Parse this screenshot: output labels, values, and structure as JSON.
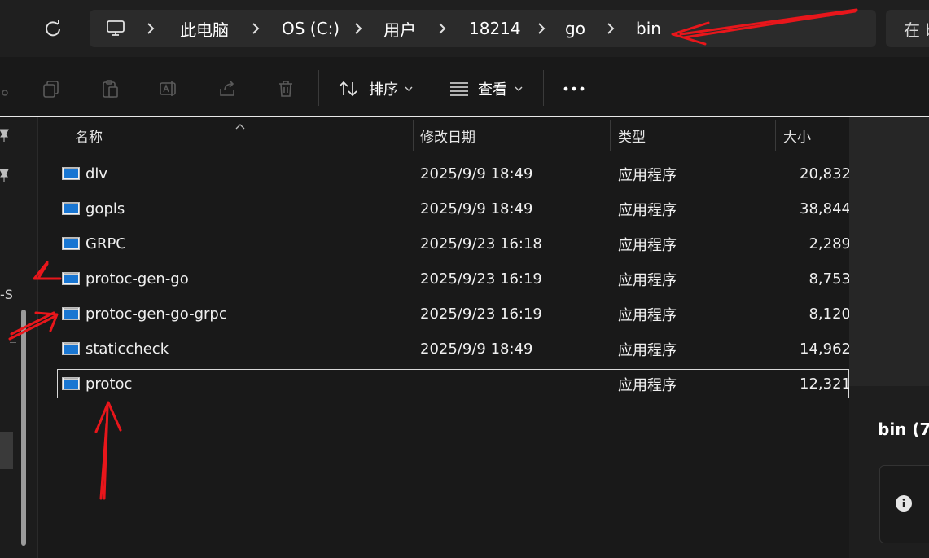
{
  "breadcrumb": {
    "items": [
      "此电脑",
      "OS (C:)",
      "用户",
      "18214",
      "go",
      "bin"
    ]
  },
  "search": {
    "label": "在 b"
  },
  "toolbar": {
    "sort_label": "排序",
    "view_label": "查看"
  },
  "left_pane": {
    "partial_text": "-S"
  },
  "columns": {
    "name": "名称",
    "modified": "修改日期",
    "type": "类型",
    "size": "大小"
  },
  "files": [
    {
      "name": "dlv",
      "modified": "2025/9/9 18:49",
      "type": "应用程序",
      "size": "20,832"
    },
    {
      "name": "gopls",
      "modified": "2025/9/9 18:49",
      "type": "应用程序",
      "size": "38,844"
    },
    {
      "name": "GRPC",
      "modified": "2025/9/23 16:18",
      "type": "应用程序",
      "size": "2,289"
    },
    {
      "name": "protoc-gen-go",
      "modified": "2025/9/23 16:19",
      "type": "应用程序",
      "size": "8,753"
    },
    {
      "name": "protoc-gen-go-grpc",
      "modified": "2025/9/23 16:19",
      "type": "应用程序",
      "size": "8,120"
    },
    {
      "name": "staticcheck",
      "modified": "2025/9/9 18:49",
      "type": "应用程序",
      "size": "14,962"
    },
    {
      "name": "protoc",
      "modified": "",
      "type": "应用程序",
      "size": "12,321"
    }
  ],
  "selected_index": 6,
  "details_pane": {
    "title": "bin (7"
  },
  "colors": {
    "background": "#191919",
    "annotation_red": "#e8161b",
    "exe_icon_blue": "#1976d2"
  },
  "icons": {
    "refresh": "refresh-icon",
    "computer": "computer-icon",
    "copy": "copy-icon",
    "paste": "paste-icon",
    "rename": "rename-icon",
    "share": "share-icon",
    "delete": "delete-icon",
    "sort": "sort-icon",
    "view": "view-icon",
    "more": "more-icon",
    "pin": "pin-icon",
    "info": "info-icon",
    "exe": "executable-icon"
  }
}
